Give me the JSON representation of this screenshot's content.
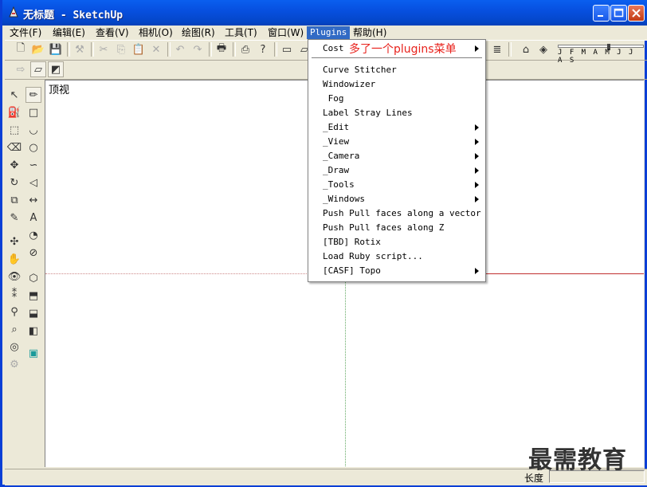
{
  "window": {
    "title": "无标题 - SketchUp"
  },
  "menubar": {
    "items": [
      {
        "label": "文件(F)"
      },
      {
        "label": "编辑(E)"
      },
      {
        "label": "查看(V)"
      },
      {
        "label": "相机(O)"
      },
      {
        "label": "绘图(R)"
      },
      {
        "label": "工具(T)"
      },
      {
        "label": "窗口(W)"
      },
      {
        "label": "Plugins"
      },
      {
        "label": "帮助(H)"
      }
    ]
  },
  "plugins_menu": {
    "items": [
      {
        "label": "Cost",
        "submenu": true
      },
      {
        "label": "Curve Stitcher",
        "submenu": false
      },
      {
        "label": "Windowizer",
        "submenu": false
      },
      {
        "label": " Fog",
        "submenu": false
      },
      {
        "label": "Label Stray Lines",
        "submenu": false
      },
      {
        "label": "_Edit",
        "submenu": true
      },
      {
        "label": "_View",
        "submenu": true
      },
      {
        "label": "_Camera",
        "submenu": true
      },
      {
        "label": "_Draw",
        "submenu": true
      },
      {
        "label": "_Tools",
        "submenu": true
      },
      {
        "label": "_Windows",
        "submenu": true
      },
      {
        "label": "Push Pull faces along a vector",
        "submenu": false
      },
      {
        "label": "Push Pull faces along Z",
        "submenu": false
      },
      {
        "label": "[TBD] Rotix",
        "submenu": false
      },
      {
        "label": "Load Ruby script...",
        "submenu": false
      },
      {
        "label": "[CASF] Topo",
        "submenu": true
      }
    ]
  },
  "annotation": {
    "text": "多了一个plugins菜单"
  },
  "viewport": {
    "view_label": "顶视"
  },
  "timeline": {
    "months": "J F M A M J J A S"
  },
  "statusbar": {
    "length_label": "长度",
    "length_value": ""
  },
  "watermark": {
    "text": "最需教育"
  },
  "colors": {
    "titlebar": "#0a5fef",
    "menu_highlight": "#316ac5",
    "annotation": "#e8221c"
  }
}
